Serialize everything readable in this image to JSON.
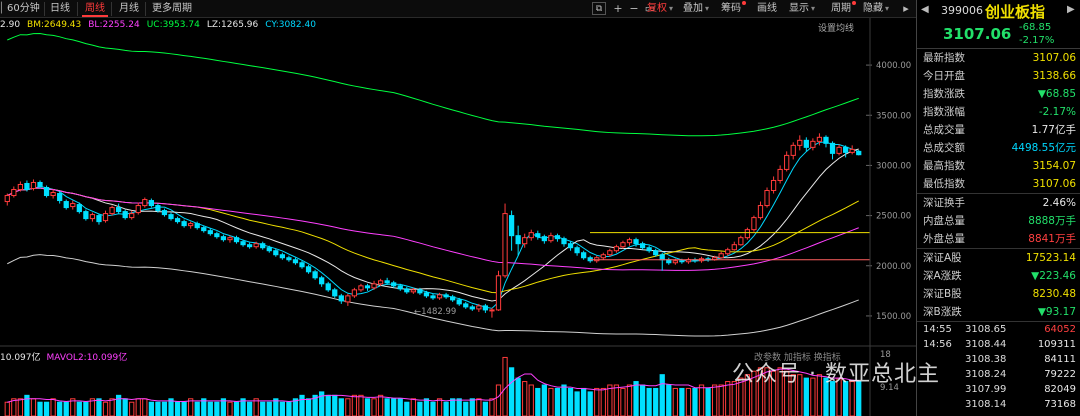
{
  "toolbar": {
    "period_tabs": [
      "60分钟",
      "日线",
      "周线",
      "月线",
      "更多周期"
    ],
    "active_tab": "周线",
    "fuquan": "复权",
    "overlay": "叠加",
    "chouma": "筹码",
    "huaxian": "画线",
    "display": "显示",
    "period_cycle": "周期",
    "hide": "隐藏"
  },
  "ma_legend": [
    {
      "label": "2.90",
      "color": "#e8e8e8"
    },
    {
      "label": "BM:2649.43",
      "color": "#f0e000"
    },
    {
      "label": "BL:2255.24",
      "color": "#ff40ff"
    },
    {
      "label": "UC:3953.74",
      "color": "#00ff40"
    },
    {
      "label": "LZ:1265.96",
      "color": "#e8e8e8"
    },
    {
      "label": "CY:3082.40",
      "color": "#00d8ff"
    }
  ],
  "settings_label": "设置均线",
  "y_axis_labels": [
    "4000.00",
    "3500.00",
    "3000.00",
    "2500.00",
    "2000.00",
    "1500.00"
  ],
  "low_marker": "1482.99",
  "volume": {
    "legend": [
      {
        "label": "10.097亿",
        "color": "#e8e8e8"
      },
      {
        "label": "MAVOL2:10.099亿",
        "color": "#ff40ff"
      }
    ],
    "tools": "改参数  加指标  换指标",
    "y_labels": [
      "18",
      "9.14"
    ]
  },
  "quote": {
    "code": "399006",
    "name": "创业板指",
    "price": "3107.06",
    "change": "-68.85",
    "change_pct": "-2.17%",
    "rows": [
      {
        "label": "最新指数",
        "value": "3107.06",
        "color": "yellow"
      },
      {
        "label": "今日开盘",
        "value": "3138.66",
        "color": "yellow"
      },
      {
        "label": "指数涨跌",
        "value": "▼68.85",
        "color": "green"
      },
      {
        "label": "指数涨幅",
        "value": "-2.17%",
        "color": "green"
      },
      {
        "label": "总成交量",
        "value": "1.77亿手",
        "color": "white"
      },
      {
        "label": "总成交额",
        "value": "4498.55亿元",
        "color": "cyan"
      },
      {
        "label": "最高指数",
        "value": "3154.07",
        "color": "yellow"
      },
      {
        "label": "最低指数",
        "value": "3107.06",
        "color": "yellow"
      }
    ],
    "rows2": [
      {
        "label": "深证换手",
        "value": "2.46%",
        "color": "white"
      },
      {
        "label": "内盘总量",
        "value": "8888万手",
        "color": "green"
      },
      {
        "label": "外盘总量",
        "value": "8841万手",
        "color": "red"
      }
    ],
    "rows3": [
      {
        "label": "深证A股",
        "value": "17523.14",
        "color": "yellow"
      },
      {
        "label": "深A涨跌",
        "value": "▼223.46",
        "color": "green"
      },
      {
        "label": "深证B股",
        "value": "8230.48",
        "color": "yellow"
      },
      {
        "label": "深B涨跌",
        "value": "▼93.17",
        "color": "green"
      }
    ],
    "ticks": [
      {
        "time": "14:55",
        "price": "3108.65",
        "vol": "64052",
        "vcolor": "red"
      },
      {
        "time": "14:56",
        "price": "3108.44",
        "vol": "109311",
        "vcolor": "white"
      },
      {
        "time": "",
        "price": "3108.38",
        "vol": "84111",
        "vcolor": "white"
      },
      {
        "time": "",
        "price": "3108.24",
        "vol": "79222",
        "vcolor": "white"
      },
      {
        "time": "",
        "price": "3107.99",
        "vol": "82049",
        "vcolor": "white"
      },
      {
        "time": "",
        "price": "3108.14",
        "vol": "73168",
        "vcolor": "white"
      }
    ]
  },
  "watermark": "公众号 · 数亚总北主",
  "chart_data": {
    "type": "candlestick",
    "period": "weekly",
    "ylim": [
      1300,
      4250
    ],
    "low_annotation": 1482.99,
    "candles": [
      [
        2640,
        2700,
        2600,
        2720
      ],
      [
        2700,
        2760,
        2680,
        2790
      ],
      [
        2760,
        2810,
        2740,
        2840
      ],
      [
        2820,
        2760,
        2740,
        2850
      ],
      [
        2770,
        2830,
        2750,
        2860
      ],
      [
        2830,
        2790,
        2770,
        2850
      ],
      [
        2780,
        2700,
        2680,
        2800
      ],
      [
        2700,
        2730,
        2670,
        2760
      ],
      [
        2720,
        2650,
        2620,
        2740
      ],
      [
        2640,
        2580,
        2560,
        2660
      ],
      [
        2590,
        2620,
        2560,
        2650
      ],
      [
        2610,
        2540,
        2520,
        2630
      ],
      [
        2540,
        2470,
        2450,
        2560
      ],
      [
        2470,
        2510,
        2440,
        2530
      ],
      [
        2500,
        2440,
        2410,
        2520
      ],
      [
        2450,
        2520,
        2430,
        2550
      ],
      [
        2520,
        2580,
        2500,
        2600
      ],
      [
        2580,
        2540,
        2520,
        2620
      ],
      [
        2540,
        2480,
        2460,
        2560
      ],
      [
        2480,
        2520,
        2460,
        2550
      ],
      [
        2530,
        2600,
        2510,
        2630
      ],
      [
        2600,
        2660,
        2580,
        2680
      ],
      [
        2650,
        2600,
        2580,
        2670
      ],
      [
        2600,
        2550,
        2530,
        2620
      ],
      [
        2550,
        2510,
        2490,
        2570
      ],
      [
        2510,
        2470,
        2450,
        2530
      ],
      [
        2470,
        2440,
        2420,
        2490
      ],
      [
        2440,
        2400,
        2380,
        2460
      ],
      [
        2400,
        2420,
        2370,
        2440
      ],
      [
        2420,
        2380,
        2360,
        2440
      ],
      [
        2380,
        2350,
        2330,
        2400
      ],
      [
        2350,
        2320,
        2300,
        2370
      ],
      [
        2320,
        2290,
        2270,
        2340
      ],
      [
        2290,
        2260,
        2240,
        2310
      ],
      [
        2260,
        2280,
        2230,
        2300
      ],
      [
        2280,
        2240,
        2220,
        2300
      ],
      [
        2240,
        2210,
        2190,
        2260
      ],
      [
        2210,
        2190,
        2170,
        2230
      ],
      [
        2190,
        2220,
        2170,
        2240
      ],
      [
        2220,
        2180,
        2160,
        2240
      ],
      [
        2180,
        2150,
        2130,
        2200
      ],
      [
        2150,
        2110,
        2090,
        2170
      ],
      [
        2110,
        2080,
        2060,
        2130
      ],
      [
        2080,
        2060,
        2040,
        2100
      ],
      [
        2060,
        2030,
        2010,
        2080
      ],
      [
        2030,
        1990,
        1970,
        2050
      ],
      [
        1990,
        1940,
        1920,
        2010
      ],
      [
        1940,
        1880,
        1860,
        1960
      ],
      [
        1880,
        1820,
        1790,
        1900
      ],
      [
        1820,
        1760,
        1740,
        1840
      ],
      [
        1760,
        1700,
        1680,
        1780
      ],
      [
        1700,
        1650,
        1620,
        1720
      ],
      [
        1640,
        1700,
        1600,
        1720
      ],
      [
        1700,
        1760,
        1680,
        1780
      ],
      [
        1760,
        1800,
        1740,
        1820
      ],
      [
        1800,
        1780,
        1750,
        1820
      ],
      [
        1780,
        1820,
        1760,
        1850
      ],
      [
        1820,
        1850,
        1800,
        1870
      ],
      [
        1850,
        1830,
        1810,
        1880
      ],
      [
        1830,
        1800,
        1780,
        1850
      ],
      [
        1800,
        1770,
        1750,
        1820
      ],
      [
        1770,
        1740,
        1720,
        1790
      ],
      [
        1740,
        1760,
        1720,
        1780
      ],
      [
        1760,
        1730,
        1710,
        1780
      ],
      [
        1730,
        1700,
        1680,
        1750
      ],
      [
        1700,
        1680,
        1660,
        1720
      ],
      [
        1680,
        1710,
        1660,
        1730
      ],
      [
        1710,
        1690,
        1670,
        1730
      ],
      [
        1690,
        1660,
        1640,
        1710
      ],
      [
        1660,
        1620,
        1600,
        1680
      ],
      [
        1620,
        1590,
        1570,
        1640
      ],
      [
        1590,
        1570,
        1550,
        1610
      ],
      [
        1570,
        1600,
        1540,
        1620
      ],
      [
        1600,
        1560,
        1530,
        1620
      ],
      [
        1560,
        1560,
        1483,
        1580
      ],
      [
        1560,
        1900,
        1550,
        1950
      ],
      [
        1900,
        2520,
        1880,
        2620
      ],
      [
        2500,
        2300,
        2150,
        2550
      ],
      [
        2300,
        2220,
        2100,
        2400
      ],
      [
        2220,
        2280,
        2180,
        2320
      ],
      [
        2280,
        2330,
        2250,
        2360
      ],
      [
        2320,
        2290,
        2260,
        2350
      ],
      [
        2290,
        2250,
        2220,
        2310
      ],
      [
        2250,
        2300,
        2230,
        2330
      ],
      [
        2300,
        2270,
        2240,
        2320
      ],
      [
        2270,
        2220,
        2190,
        2290
      ],
      [
        2220,
        2180,
        2150,
        2240
      ],
      [
        2180,
        2130,
        2100,
        2200
      ],
      [
        2130,
        2080,
        2060,
        2150
      ],
      [
        2080,
        2050,
        2030,
        2100
      ],
      [
        2050,
        2080,
        2030,
        2100
      ],
      [
        2080,
        2110,
        2060,
        2130
      ],
      [
        2110,
        2150,
        2090,
        2170
      ],
      [
        2150,
        2190,
        2130,
        2210
      ],
      [
        2190,
        2230,
        2170,
        2250
      ],
      [
        2230,
        2260,
        2200,
        2280
      ],
      [
        2260,
        2220,
        2190,
        2280
      ],
      [
        2220,
        2180,
        2160,
        2240
      ],
      [
        2180,
        2150,
        2130,
        2200
      ],
      [
        2150,
        2110,
        2090,
        2170
      ],
      [
        2110,
        2060,
        1950,
        2130
      ],
      [
        2060,
        2030,
        2010,
        2080
      ],
      [
        2030,
        2050,
        2010,
        2070
      ],
      [
        2050,
        2040,
        2020,
        2070
      ],
      [
        2040,
        2060,
        2020,
        2080
      ],
      [
        2060,
        2050,
        2030,
        2080
      ],
      [
        2050,
        2070,
        2030,
        2090
      ],
      [
        2070,
        2060,
        2040,
        2090
      ],
      [
        2060,
        2080,
        2050,
        2100
      ],
      [
        2080,
        2120,
        2070,
        2140
      ],
      [
        2120,
        2160,
        2100,
        2180
      ],
      [
        2160,
        2210,
        2150,
        2240
      ],
      [
        2210,
        2280,
        2200,
        2300
      ],
      [
        2280,
        2360,
        2260,
        2380
      ],
      [
        2360,
        2480,
        2340,
        2500
      ],
      [
        2480,
        2600,
        2460,
        2640
      ],
      [
        2600,
        2750,
        2580,
        2780
      ],
      [
        2750,
        2850,
        2720,
        2890
      ],
      [
        2850,
        2960,
        2820,
        3000
      ],
      [
        2960,
        3100,
        2940,
        3140
      ],
      [
        3100,
        3200,
        3060,
        3230
      ],
      [
        3200,
        3250,
        3150,
        3300
      ],
      [
        3250,
        3180,
        3140,
        3280
      ],
      [
        3180,
        3240,
        3150,
        3270
      ],
      [
        3240,
        3280,
        3200,
        3320
      ],
      [
        3280,
        3220,
        3180,
        3300
      ],
      [
        3220,
        3120,
        3060,
        3240
      ],
      [
        3120,
        3180,
        3100,
        3210
      ],
      [
        3180,
        3130,
        3080,
        3200
      ],
      [
        3130,
        3160,
        3110,
        3200
      ],
      [
        3140,
        3107,
        3100,
        3154
      ]
    ],
    "volume": [
      4,
      5,
      5,
      6,
      5,
      4,
      4,
      5,
      4,
      4,
      5,
      4,
      4,
      5,
      5,
      4,
      5,
      6,
      5,
      4,
      5,
      5,
      4,
      4,
      4,
      5,
      4,
      4,
      5,
      4,
      5,
      4,
      4,
      5,
      4,
      4,
      5,
      4,
      5,
      4,
      4,
      5,
      4,
      4,
      5,
      6,
      5,
      6,
      7,
      6,
      6,
      5,
      5,
      6,
      6,
      5,
      5,
      6,
      5,
      5,
      5,
      4,
      5,
      4,
      5,
      4,
      5,
      4,
      5,
      5,
      4,
      5,
      5,
      4,
      5,
      9,
      17,
      14,
      11,
      10,
      9,
      8,
      9,
      8,
      8,
      9,
      8,
      7,
      8,
      7,
      8,
      8,
      9,
      9,
      8,
      9,
      10,
      9,
      8,
      8,
      12,
      9,
      8,
      8,
      8,
      8,
      9,
      8,
      9,
      9,
      10,
      10,
      11,
      12,
      13,
      14,
      14,
      13,
      14,
      13,
      12,
      12,
      11,
      11,
      12,
      11,
      10,
      11,
      10,
      10,
      10
    ],
    "ma_series_note": "BM yellow, BL magenta, UC green, CY cyan, LZ white"
  }
}
